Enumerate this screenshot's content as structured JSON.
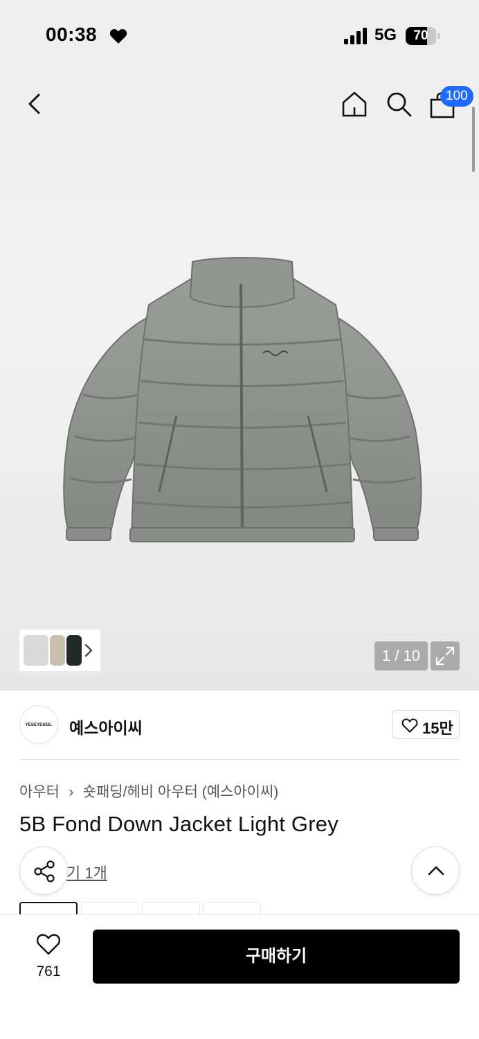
{
  "status_bar": {
    "time": "00:38",
    "network": "5G",
    "battery": "70",
    "battery_level": 0.7
  },
  "header": {
    "cart_count": "100"
  },
  "gallery": {
    "page_counter": "1 / 10"
  },
  "brand": {
    "logo_text": "YESEYESEE.",
    "name": "예스아이씨",
    "likes": "15만"
  },
  "product": {
    "breadcrumb": [
      "아우터",
      "숏패딩/헤비 아우터 (예스아이씨)"
    ],
    "title": "5B Fond Down Jacket Light Grey",
    "review_link": "기 1개"
  },
  "bottom_bar": {
    "wish_count": "761",
    "buy_label": "구매하기"
  },
  "colors": {
    "accent": "#1f6bff",
    "buy_button": "#000000",
    "jacket": "#8f918f"
  },
  "icons": [
    "heart-icon",
    "signal-icon",
    "back-icon",
    "home-icon",
    "search-icon",
    "cart-icon",
    "chevron-right-icon",
    "expand-icon",
    "share-icon",
    "chevron-up-icon"
  ]
}
